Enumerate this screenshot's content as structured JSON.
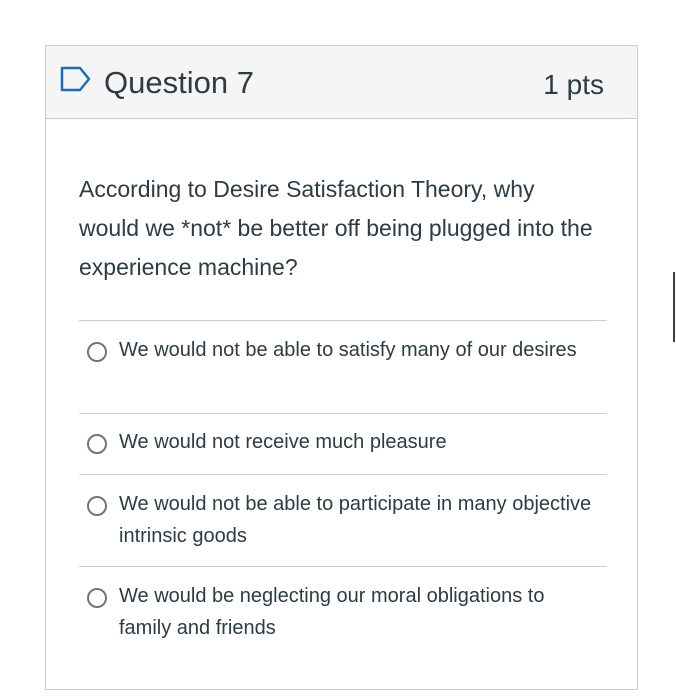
{
  "question": {
    "title": "Question 7",
    "points": "1 pts",
    "text": "According to Desire Satisfaction Theory, why would we *not* be better off being plugged into the experience machine?",
    "flag_icon": "flag-outline-icon"
  },
  "answers": [
    {
      "label": "We would not be able to satisfy many of our desires",
      "selected": false
    },
    {
      "label": "We would not receive much pleasure",
      "selected": false
    },
    {
      "label": "We would not be able to participate in many objective intrinsic goods",
      "selected": false
    },
    {
      "label": "We would be neglecting our moral obligations to family and friends",
      "selected": false
    }
  ],
  "colors": {
    "text": "#2d3b45",
    "header_bg": "#f5f5f5",
    "border": "#c7cdd1",
    "flag": "#1a6eb7"
  }
}
